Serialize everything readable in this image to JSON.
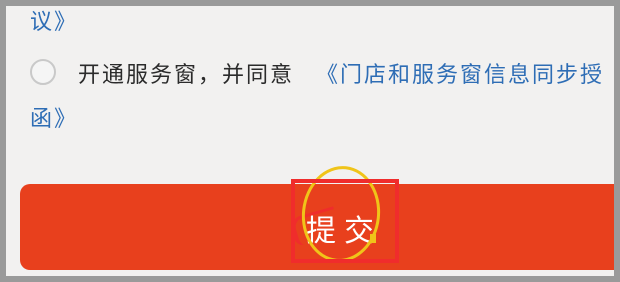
{
  "agreement": {
    "line1_link": "议》",
    "checkbox_label": "开通服务窗，并同意",
    "line2_link": "《门店和服务窗信息同步授",
    "line3_link": "函》"
  },
  "submit": {
    "label": "提交"
  },
  "colors": {
    "link": "#2e6db5",
    "button": "#e8401d",
    "annotation_red": "#f02c2c",
    "annotation_yellow": "#f0c419"
  }
}
